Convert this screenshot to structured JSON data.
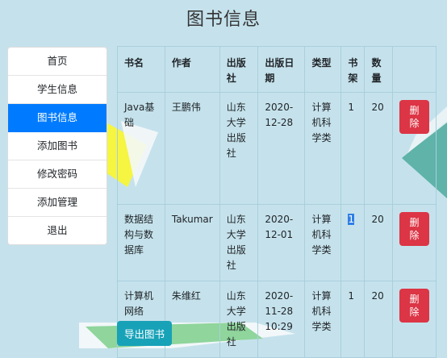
{
  "page_title": "图书信息",
  "sidebar": {
    "items": [
      {
        "label": "首页"
      },
      {
        "label": "学生信息"
      },
      {
        "label": "图书信息"
      },
      {
        "label": "添加图书"
      },
      {
        "label": "修改密码"
      },
      {
        "label": "添加管理"
      },
      {
        "label": "退出"
      }
    ]
  },
  "table": {
    "headers": [
      "书名",
      "作者",
      "出版社",
      "出版日期",
      "类型",
      "书架",
      "数量",
      ""
    ],
    "rows": [
      {
        "title": "Java基础",
        "author": "王鹏伟",
        "publisher": "山东大学出版社",
        "date": "2020-12-28",
        "type": "计算机科学类",
        "shelf": "1",
        "count": "20",
        "action": "删除"
      },
      {
        "title": "数据结构与数据库",
        "author": "Takumar",
        "publisher": "山东大学出版社",
        "date": "2020-12-01",
        "type": "计算机科学类",
        "shelf": "1",
        "count": "20",
        "action": "删除"
      },
      {
        "title": "计算机网络",
        "author": "朱维红",
        "publisher": "山东大学出版社",
        "date": "2020-11-28 10:29",
        "type": "计算机科学类",
        "shelf": "1",
        "count": "20",
        "action": "删除"
      }
    ]
  },
  "export_button": "导出图书",
  "colors": {
    "background": "#c5e2ec",
    "active_nav": "#007bff",
    "danger": "#dc3545",
    "info": "#17a2b8"
  }
}
